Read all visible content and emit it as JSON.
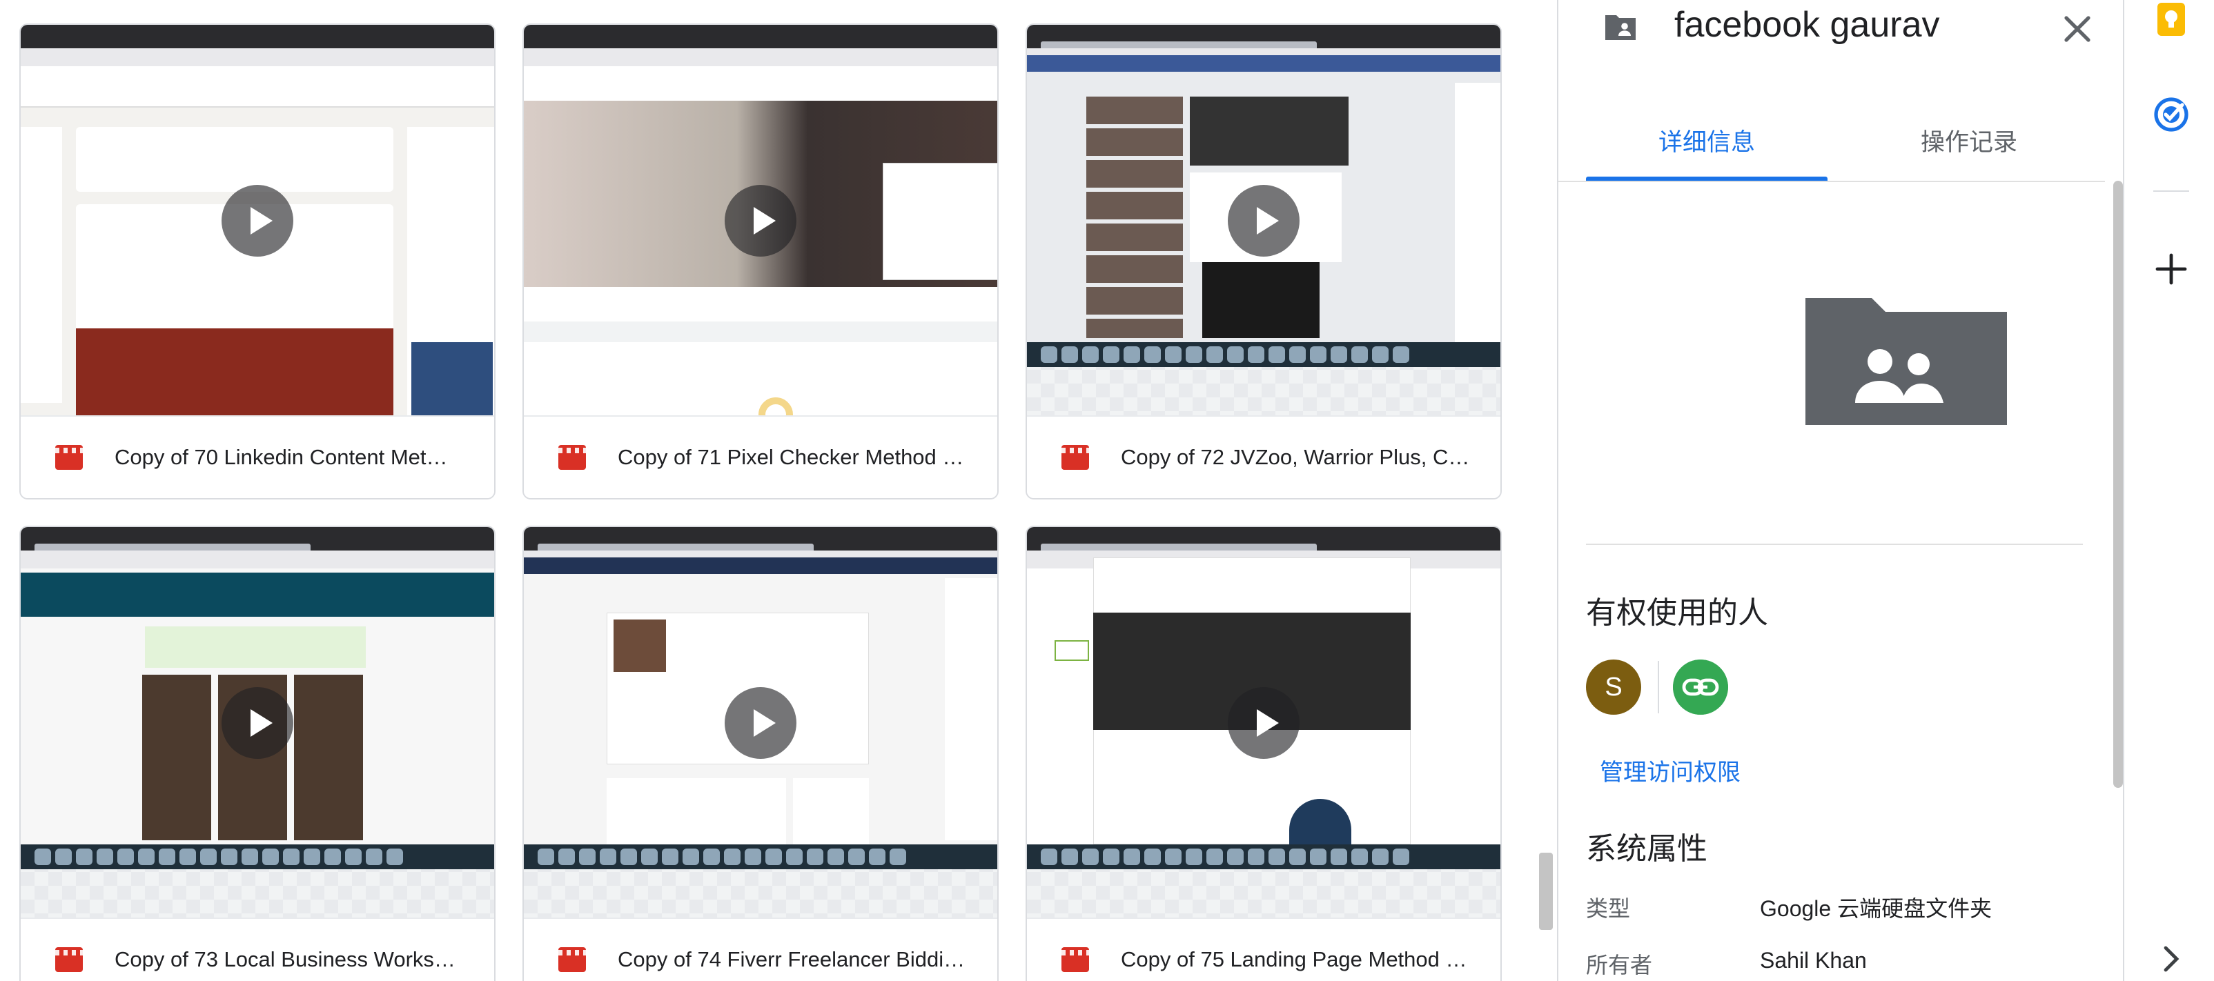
{
  "files": [
    {
      "title": "Copy of 70 Linkedin Content Met…",
      "accent": "#0a66c2"
    },
    {
      "title": "Copy of 71 Pixel Checker Method …",
      "accent": "#e9d6d6"
    },
    {
      "title": "Copy of 72 JVZoo, Warrior Plus, C…",
      "accent": "#3b5998"
    },
    {
      "title": "Copy of 73 Local Business Works…",
      "accent": "#0b4a5e"
    },
    {
      "title": "Copy of 74 Fiverr Freelancer Biddi…",
      "accent": "#223355"
    },
    {
      "title": "Copy of 75 Landing Page Method …",
      "accent": "#2b2b2b"
    }
  ],
  "panel": {
    "title": "facebook gaurav",
    "icon": "folder-shared-icon",
    "tabs": [
      "详细信息",
      "操作记录"
    ],
    "active_tab": 0,
    "access": {
      "heading": "有权使用的人",
      "avatar_letter": "S",
      "avatar_color": "#7c5d10",
      "manage_label": "管理访问权限"
    },
    "properties": {
      "heading": "系统属性",
      "rows": [
        {
          "key": "类型",
          "value": "Google 云端硬盘文件夹"
        },
        {
          "key": "所有者",
          "value": "Sahil Khan"
        }
      ]
    }
  },
  "colors": {
    "accent_blue": "#1a73e8",
    "video_red": "#d93025",
    "link_green": "#34a853",
    "keep_yellow": "#fbbc04"
  },
  "rail": [
    "keep-icon",
    "tasks-icon",
    "add-icon",
    "chevron-right-icon"
  ]
}
